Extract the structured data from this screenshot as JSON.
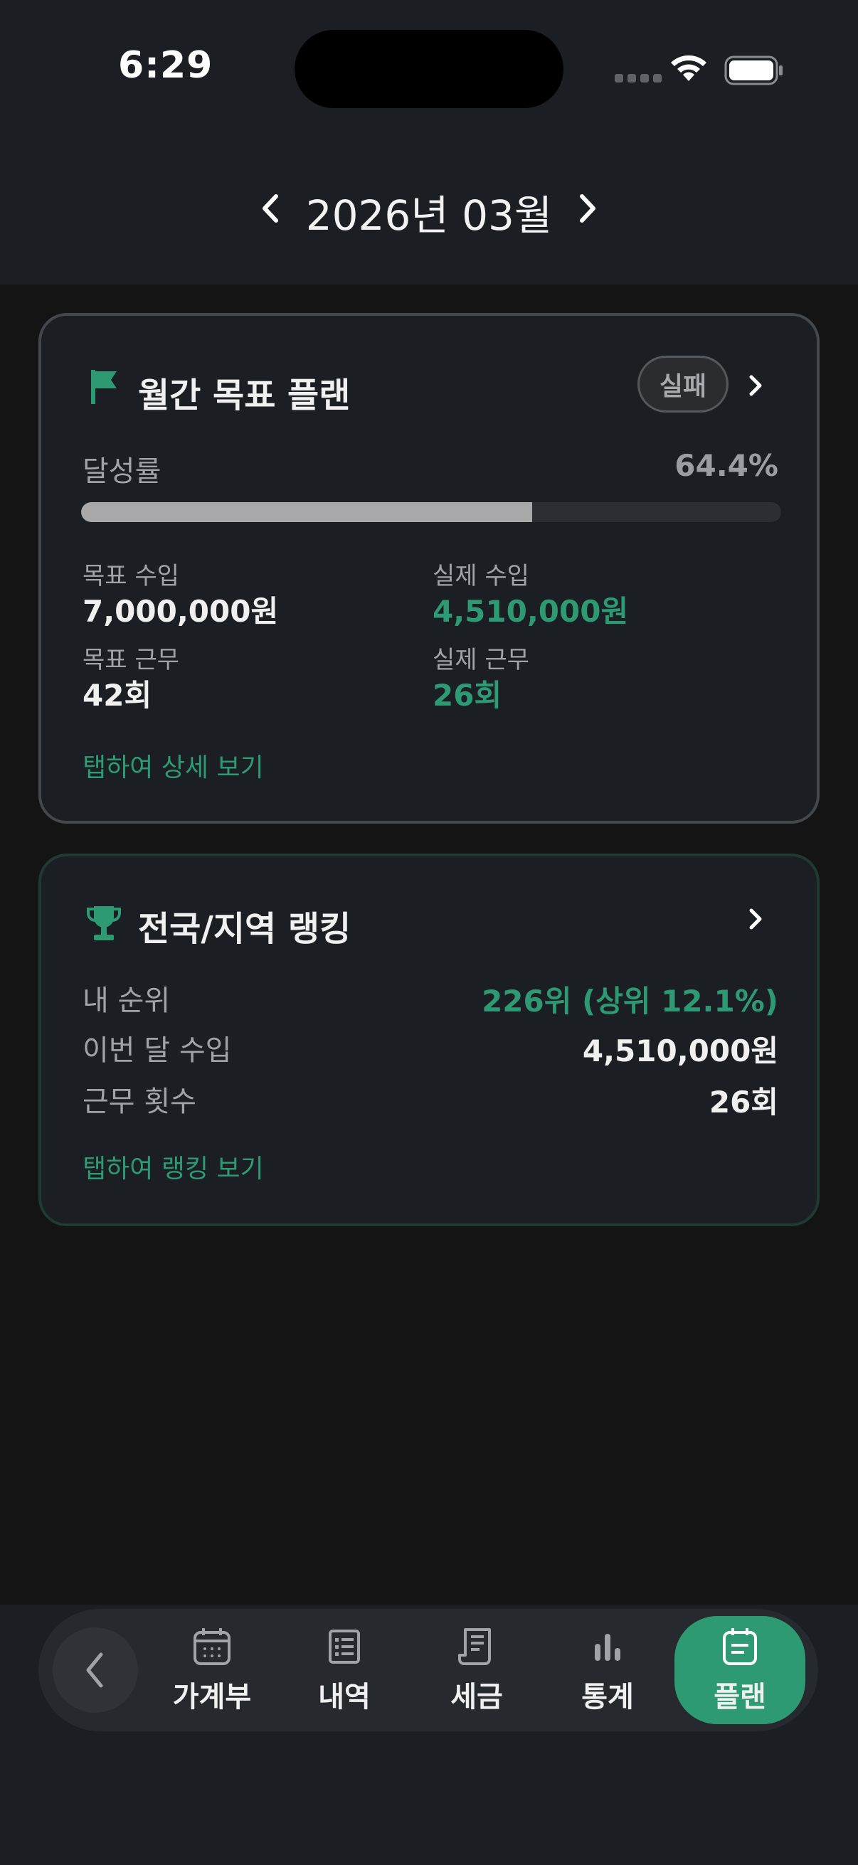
{
  "status_bar": {
    "time": "6:29"
  },
  "month_nav": {
    "label": "2026년 03월"
  },
  "plan_card": {
    "title": "월간 목표 플랜",
    "status_badge": "실패",
    "achievement_label": "달성률",
    "achievement_value": "64.4%",
    "achievement_fraction": 0.644,
    "target_income_label": "목표 수입",
    "target_income_value": "7,000,000원",
    "actual_income_label": "실제 수입",
    "actual_income_value": "4,510,000원",
    "target_work_label": "목표 근무",
    "target_work_value": "42회",
    "actual_work_label": "실제 근무",
    "actual_work_value": "26회",
    "detail_link": "탭하여 상세 보기"
  },
  "ranking_card": {
    "title": "전국/지역 랭킹",
    "rows": [
      {
        "label": "내 순위",
        "value": "226위 (상위 12.1%)"
      },
      {
        "label": "이번 달 수입",
        "value": "4,510,000원"
      },
      {
        "label": "근무 횟수",
        "value": "26회"
      }
    ],
    "ranking_link": "탭하여 랭킹 보기"
  },
  "tab_bar": {
    "tabs": [
      {
        "label": "가계부",
        "icon": "calendar-icon"
      },
      {
        "label": "내역",
        "icon": "list-icon"
      },
      {
        "label": "세금",
        "icon": "receipt-icon"
      },
      {
        "label": "통계",
        "icon": "bar-chart-icon"
      },
      {
        "label": "플랜",
        "icon": "plan-icon",
        "active": true
      }
    ]
  },
  "colors": {
    "accent": "#2e9a74",
    "background": "#141414",
    "card": "#1b1e22"
  }
}
